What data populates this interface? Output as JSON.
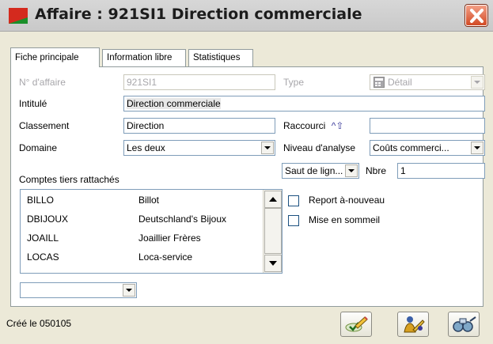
{
  "window": {
    "title": "Affaire : 921SI1 Direction commerciale",
    "close_icon": "close-icon",
    "app_icon": "folder-icon"
  },
  "tabs": [
    {
      "label": "Fiche principale",
      "active": true
    },
    {
      "label": "Information libre",
      "active": false
    },
    {
      "label": "Statistiques",
      "active": false
    }
  ],
  "form": {
    "numero": {
      "label": "N° d'affaire",
      "value": "921SI1",
      "disabled": true
    },
    "type": {
      "label": "Type",
      "value": "Détail",
      "disabled": true,
      "icon": "calculator-icon"
    },
    "intitule": {
      "label": "Intitulé",
      "value": "Direction commerciale"
    },
    "classement": {
      "label": "Classement",
      "value": "Direction"
    },
    "raccourci": {
      "label": "Raccourci",
      "shortcut_symbol": "^⇧",
      "value": ""
    },
    "domaine": {
      "label": "Domaine",
      "value": "Les deux"
    },
    "niveau": {
      "label": "Niveau d'analyse",
      "value": "Coûts commerci..."
    },
    "saut": {
      "value": "Saut de lign..."
    },
    "nbre": {
      "label": "Nbre",
      "value": "1"
    },
    "comptes_label": "Comptes tiers rattachés",
    "comptes": [
      {
        "code": "BILLO",
        "name": "Billot"
      },
      {
        "code": "DBIJOUX",
        "name": "Deutschland's Bijoux"
      },
      {
        "code": "JOAILL",
        "name": "Joaillier Frères"
      },
      {
        "code": "LOCAS",
        "name": "Loca-service"
      }
    ],
    "comptes_combo": {
      "value": ""
    },
    "report": {
      "label": "Report à-nouveau",
      "checked": false
    },
    "sommeil": {
      "label": "Mise en sommeil",
      "checked": false
    }
  },
  "status": {
    "created": "Créé le  050105"
  },
  "toolbar": [
    {
      "name": "validate-button",
      "icon": "pencil-check-icon"
    },
    {
      "name": "person-button",
      "icon": "person-icon"
    },
    {
      "name": "search-button",
      "icon": "binoculars-icon"
    }
  ]
}
